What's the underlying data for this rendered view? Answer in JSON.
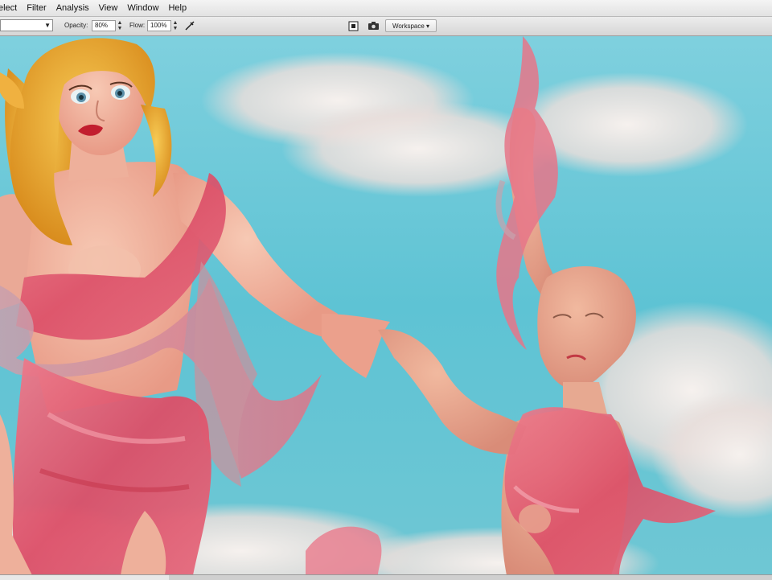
{
  "menu": [
    "elect",
    "Filter",
    "Analysis",
    "View",
    "Window",
    "Help"
  ],
  "options": {
    "opacity_label": "Opacity:",
    "opacity_value": "80%",
    "flow_label": "Flow:",
    "flow_value": "100%",
    "workspace_label": "Workspace ▾"
  },
  "canvas": {
    "sky_color": "#5ec3d4",
    "sky_light": "#9fdfe8",
    "cloud_color": "#f1ece9",
    "skin_color": "#f0b49c",
    "fabric_color": "#e0566d",
    "hair_color": "#f2b23a"
  }
}
